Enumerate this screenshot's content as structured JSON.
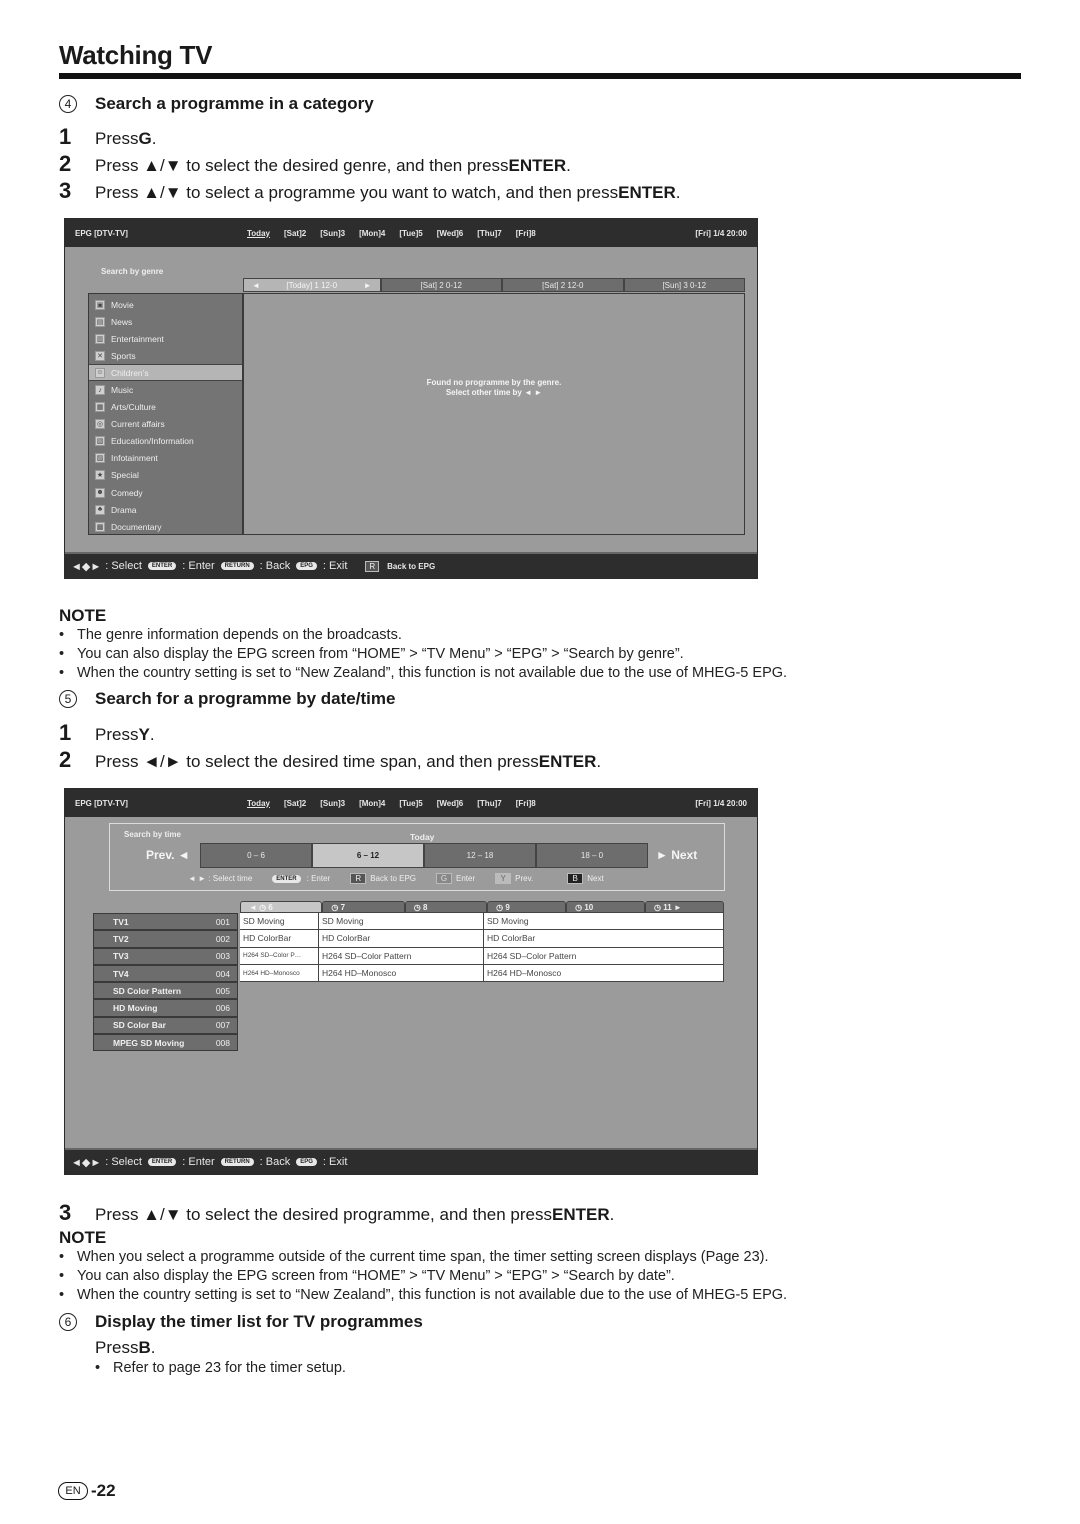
{
  "page": {
    "title": "Watching TV",
    "page_number": "-22",
    "lang_badge": "EN"
  },
  "section4": {
    "number": "4",
    "heading": "Search a programme in a category",
    "steps": [
      {
        "num": "1",
        "pre": "Press ",
        "key": "G",
        "post": "."
      },
      {
        "num": "2",
        "pre": "Press ▲/▼ to select the desired genre, and then press ",
        "key": "ENTER",
        "post": "."
      },
      {
        "num": "3",
        "pre": "Press ▲/▼ to select a programme you want to watch, and then press ",
        "key": "ENTER",
        "post": "."
      }
    ],
    "note_title": "NOTE",
    "notes": [
      "The genre information depends on the broadcasts.",
      "You can also display the EPG screen from “HOME” > “TV Menu” > “EPG” > “Search by genre”.",
      "When the country setting is set to “New Zealand”, this function is not available due to the use of MHEG-5 EPG."
    ]
  },
  "epg_common": {
    "app": "EPG [DTV-TV]",
    "days": [
      "Today",
      "[Sat]2",
      "[Sun]3",
      "[Mon]4",
      "[Tue]5",
      "[Wed]6",
      "[Thu]7",
      "[Fri]8"
    ],
    "clock": "[Fri]  1/4  20:00",
    "footer": {
      "select": ": Select",
      "enter_key": "ENTER",
      "enter": ": Enter",
      "return_key": "RETURN",
      "back": ": Back",
      "epg_key": "EPG",
      "exit": ": Exit"
    }
  },
  "genre_screen": {
    "label": "Search by genre",
    "date_tabs": [
      "[Today] 1 12-0",
      "[Sat] 2 0-12",
      "[Sat] 2 12-0",
      "[Sun] 3 0-12"
    ],
    "genres": [
      {
        "label": "Movie",
        "icon": "movie-icon"
      },
      {
        "label": "News",
        "icon": "news-icon"
      },
      {
        "label": "Entertainment",
        "icon": "entertainment-icon"
      },
      {
        "label": "Sports",
        "icon": "sports-icon"
      },
      {
        "label": "Children’s",
        "icon": "childrens-icon",
        "selected": true
      },
      {
        "label": "Music",
        "icon": "music-icon"
      },
      {
        "label": "Arts/Culture",
        "icon": "arts-icon"
      },
      {
        "label": "Current affairs",
        "icon": "current-affairs-icon"
      },
      {
        "label": "Education/Information",
        "icon": "education-icon"
      },
      {
        "label": "Infotainment",
        "icon": "infotainment-icon"
      },
      {
        "label": "Special",
        "icon": "special-icon"
      },
      {
        "label": "Comedy",
        "icon": "comedy-icon"
      },
      {
        "label": "Drama",
        "icon": "drama-icon"
      },
      {
        "label": "Documentary",
        "icon": "documentary-icon"
      }
    ],
    "message_line1": "Found no programme by the genre.",
    "message_line2": "Select other time by ◄ ►",
    "back_key": "R",
    "back_label": "Back to EPG"
  },
  "section5": {
    "number": "5",
    "heading": "Search for a programme by date/time",
    "steps": [
      {
        "num": "1",
        "pre": "Press ",
        "key": "Y",
        "post": "."
      },
      {
        "num": "2",
        "pre": "Press ◄/► to select the desired time span, and then press ",
        "key": "ENTER",
        "post": "."
      },
      {
        "num": "3",
        "pre": "Press ▲/▼ to select the desired programme, and then press ",
        "key": "ENTER",
        "post": "."
      }
    ],
    "note_title": "NOTE",
    "notes": [
      "When you select a programme outside of the current time span, the timer setting screen displays (Page 23).",
      "You can also display the EPG screen from “HOME” > “TV Menu” > “EPG” > “Search by date”.",
      "When the country setting is set to “New Zealand”, this function is not available due to the use of MHEG-5 EPG."
    ]
  },
  "time_screen": {
    "label": "Search by time",
    "day": "Today",
    "prev": "Prev. ◄",
    "next": "► Next",
    "slots": [
      {
        "label": "0 – 6"
      },
      {
        "label": "6 – 12",
        "selected": true
      },
      {
        "label": "12 – 18"
      },
      {
        "label": "18 – 0"
      }
    ],
    "hints": {
      "select_time": "◄  ► : Select time",
      "enter_key": "ENTER",
      "enter": ": Enter",
      "r_key": "R",
      "back": "Back to EPG",
      "g_key": "G",
      "g_label": "Enter",
      "y_key": "Y",
      "y_label": "Prev.",
      "b_key": "B",
      "b_label": "Next"
    },
    "hours": [
      "◄  ◷  6",
      "◷  7",
      "◷  8",
      "◷  9",
      "◷  10",
      "◷  11   ►"
    ],
    "channels": [
      {
        "name": "TV1",
        "num": "001"
      },
      {
        "name": "TV2",
        "num": "002"
      },
      {
        "name": "TV3",
        "num": "003"
      },
      {
        "name": "TV4",
        "num": "004"
      },
      {
        "name": "SD Color Pattern",
        "num": "005"
      },
      {
        "name": "HD Moving",
        "num": "006"
      },
      {
        "name": "SD Color Bar",
        "num": "007"
      },
      {
        "name": "MPEG SD Moving",
        "num": "008"
      }
    ],
    "programmes": [
      [
        "SD Moving",
        "SD Moving",
        "SD Moving"
      ],
      [
        "HD ColorBar",
        "HD ColorBar",
        "HD ColorBar"
      ],
      [
        "H264 SD–Color P…",
        "H264 SD–Color Pattern",
        "H264 SD–Color Pattern"
      ],
      [
        "H264 HD–Monosco",
        "H264 HD–Monosco",
        "H264 HD–Monosco"
      ]
    ]
  },
  "section6": {
    "number": "6",
    "heading": "Display the timer list for TV programmes",
    "press_pre": "Press ",
    "press_key": "B",
    "press_post": ".",
    "bullet": "Refer to page 23 for the timer setup."
  }
}
